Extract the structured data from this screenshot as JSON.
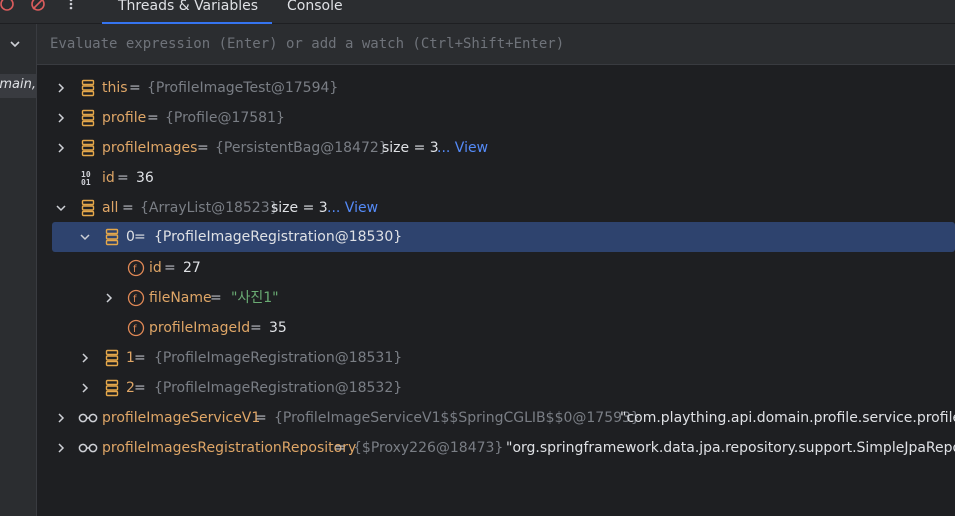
{
  "tabs": {
    "threads": "Threads & Variables",
    "console": "Console"
  },
  "frame": {
    "selected": "main,"
  },
  "evaluate": {
    "placeholder": "Evaluate expression (Enter) or add a watch (Ctrl+Shift+Enter)"
  },
  "vars": {
    "this": {
      "name": "this",
      "eq": " = ",
      "ref": "{ProfileImageTest@17594}"
    },
    "profile": {
      "name": "profile",
      "eq": " = ",
      "ref": "{Profile@17581}"
    },
    "profileImages": {
      "name": "profileImages",
      "eq": " = ",
      "ref": "{PersistentBag@18472}",
      "size": "size = 3",
      "view": "... View"
    },
    "id": {
      "name": "id",
      "eq": " = ",
      "value": "36"
    },
    "all": {
      "name": "all",
      "eq": " = ",
      "ref": "{ArrayList@18523}",
      "size": "size = 3",
      "view": "... View"
    },
    "item0": {
      "name": "0",
      "eq": " = ",
      "ref": "{ProfileImageRegistration@18530}",
      "fields": [
        {
          "name": "id",
          "eq": " = ",
          "value": "27"
        },
        {
          "name": "fileName",
          "eq": " = ",
          "value": "\"사진1\""
        },
        {
          "name": "profileImageId",
          "eq": " = ",
          "value": "35"
        }
      ]
    },
    "item1": {
      "name": "1",
      "eq": " = ",
      "ref": "{ProfileImageRegistration@18531}"
    },
    "item2": {
      "name": "2",
      "eq": " = ",
      "ref": "{ProfileImageRegistration@18532}"
    },
    "service": {
      "name": "profileImageServiceV1",
      "eq": " = ",
      "ref": "{ProfileImageServiceV1$$SpringCGLIB$$0@17593}",
      "value": "\"com.plaything.api.domain.profile.service.profileIm"
    },
    "repo": {
      "name": "profileImagesRegistrationRepository",
      "eq": " = ",
      "ref": "{$Proxy226@18473}",
      "value": "\"org.springframework.data.jpa.repository.support.SimpleJpaReposit"
    }
  },
  "colors": {
    "accent": "#3574f0",
    "selection": "#2e436e",
    "name": "#dfa667",
    "ref": "#7a7e85",
    "string": "#6aab73",
    "link": "#548af7"
  },
  "icons": [
    "rerun-icon",
    "mute-breakpoints-icon",
    "more-icon",
    "chevron-down-icon",
    "expand-arrow-icon",
    "collapse-arrow-icon",
    "object-icon",
    "primitive-icon",
    "field-icon",
    "watch-glasses-icon"
  ]
}
